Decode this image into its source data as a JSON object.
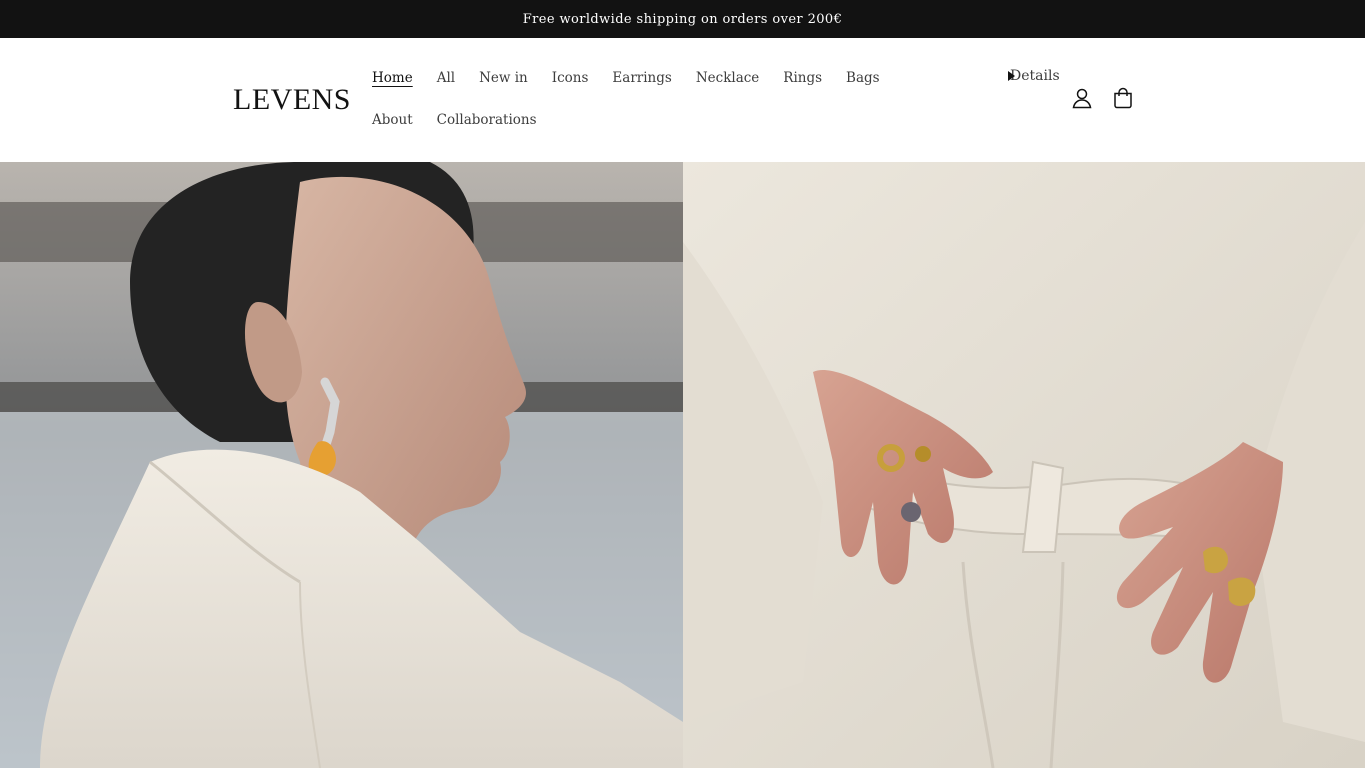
{
  "announcement": {
    "text": "Free worldwide shipping on orders over 200€"
  },
  "header": {
    "logo": "LEVENS",
    "nav": [
      {
        "label": "Home",
        "active": true
      },
      {
        "label": "All"
      },
      {
        "label": "New in"
      },
      {
        "label": "Icons"
      },
      {
        "label": "Earrings"
      },
      {
        "label": "Necklace"
      },
      {
        "label": "Rings"
      },
      {
        "label": "Bags"
      },
      {
        "label": "About"
      },
      {
        "label": "Collaborations"
      }
    ],
    "details_label": "Details",
    "icons": {
      "account": "account-icon",
      "cart": "cart-icon"
    }
  },
  "hero": {
    "left_image": "woman-profile-earring-photo",
    "right_image": "hands-rings-linen-coat-photo"
  },
  "colors": {
    "announcement_bg": "#121212",
    "text": "#121212",
    "nav_text": "#3d3d3d",
    "background": "#ffffff"
  }
}
